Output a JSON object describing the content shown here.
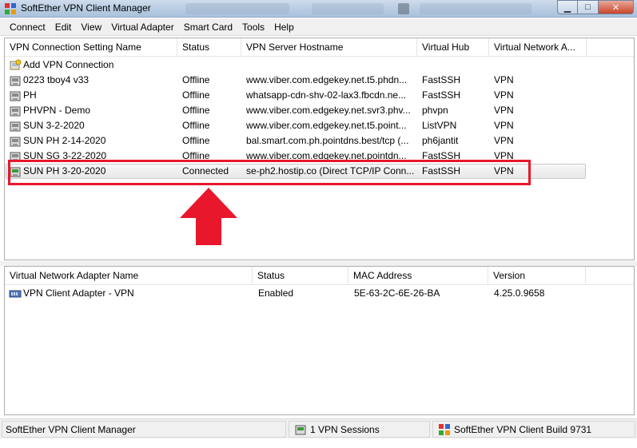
{
  "window": {
    "title": "SoftEther VPN Client Manager"
  },
  "menu": [
    "Connect",
    "Edit",
    "View",
    "Virtual Adapter",
    "Smart Card",
    "Tools",
    "Help"
  ],
  "vpn_list": {
    "columns": [
      "VPN Connection Setting Name",
      "Status",
      "VPN Server Hostname",
      "Virtual Hub",
      "Virtual Network A..."
    ],
    "add_item": "Add VPN Connection",
    "rows": [
      {
        "name": "0223 tboy4 v33",
        "status": "Offline",
        "host": "www.viber.com.edgekey.net.t5.phdn...",
        "hub": "FastSSH",
        "adapter": "VPN"
      },
      {
        "name": "PH",
        "status": "Offline",
        "host": "whatsapp-cdn-shv-02-lax3.fbcdn.ne...",
        "hub": "FastSSH",
        "adapter": "VPN"
      },
      {
        "name": "PHVPN - Demo",
        "status": "Offline",
        "host": "www.viber.com.edgekey.net.svr3.phv...",
        "hub": "phvpn",
        "adapter": "VPN"
      },
      {
        "name": "SUN 3-2-2020",
        "status": "Offline",
        "host": "www.viber.com.edgekey.net.t5.point...",
        "hub": "ListVPN",
        "adapter": "VPN"
      },
      {
        "name": "SUN PH 2-14-2020",
        "status": "Offline",
        "host": "bal.smart.com.ph.pointdns.best/tcp (...",
        "hub": "ph6jantit",
        "adapter": "VPN"
      },
      {
        "name": "SUN SG 3-22-2020",
        "status": "Offline",
        "host": "www.viber.com.edgekey.net.pointdn...",
        "hub": "FastSSH",
        "adapter": "VPN"
      },
      {
        "name": "SUN PH 3-20-2020",
        "status": "Connected",
        "host": "se-ph2.hostip.co (Direct TCP/IP Conn...",
        "hub": "FastSSH",
        "adapter": "VPN"
      }
    ]
  },
  "adapter_list": {
    "columns": [
      "Virtual Network Adapter Name",
      "Status",
      "MAC Address",
      "Version"
    ],
    "rows": [
      {
        "name": "VPN Client Adapter - VPN",
        "status": "Enabled",
        "mac": "5E-63-2C-6E-26-BA",
        "version": "4.25.0.9658"
      }
    ]
  },
  "statusbar": {
    "app": "SoftEther VPN Client Manager",
    "sessions": "1 VPN Sessions",
    "build": "SoftEther VPN Client Build 9731"
  },
  "icons": {
    "app": "softether-app-icon",
    "add": "add-connection-icon",
    "connection": "vpn-connection-icon",
    "adapter": "network-adapter-icon",
    "arrow": "red-up-arrow"
  },
  "colors": {
    "highlight": "#e8172c",
    "titlebar": "#b9cde3"
  }
}
